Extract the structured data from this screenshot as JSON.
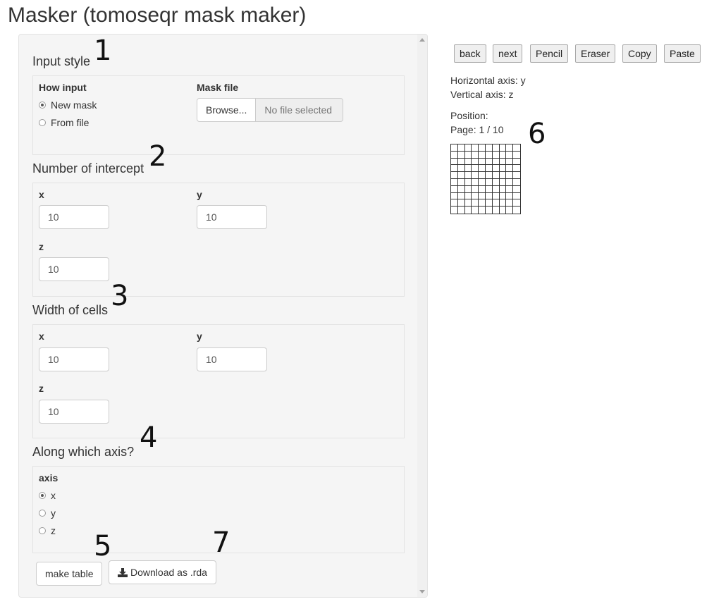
{
  "page": {
    "title": "Masker (tomoseqr mask maker)"
  },
  "input_style": {
    "title": "Input style",
    "how_input_label": "How input",
    "options": [
      "New mask",
      "From file"
    ],
    "selected": "New mask",
    "mask_file_label": "Mask file",
    "browse_label": "Browse...",
    "file_placeholder": "No file selected"
  },
  "intercept": {
    "title": "Number of intercept",
    "x_label": "x",
    "x_value": "10",
    "y_label": "y",
    "y_value": "10",
    "z_label": "z",
    "z_value": "10"
  },
  "width": {
    "title": "Width of cells",
    "x_label": "x",
    "x_value": "10",
    "y_label": "y",
    "y_value": "10",
    "z_label": "z",
    "z_value": "10"
  },
  "axis": {
    "title": "Along which axis?",
    "label": "axis",
    "options": [
      "x",
      "y",
      "z"
    ],
    "selected": "x"
  },
  "actions": {
    "make_table": "make table",
    "download": "Download as .rda"
  },
  "toolbar": {
    "back": "back",
    "next": "next",
    "pencil": "Pencil",
    "eraser": "Eraser",
    "copy": "Copy",
    "paste": "Paste"
  },
  "info": {
    "horizontal_axis": "Horizontal axis: y",
    "vertical_axis": "Vertical axis: z",
    "position": "Position:",
    "page": "Page: 1 / 10"
  },
  "grid": {
    "rows": 10,
    "cols": 10
  },
  "annotations": [
    "1",
    "2",
    "3",
    "4",
    "5",
    "6",
    "7"
  ]
}
